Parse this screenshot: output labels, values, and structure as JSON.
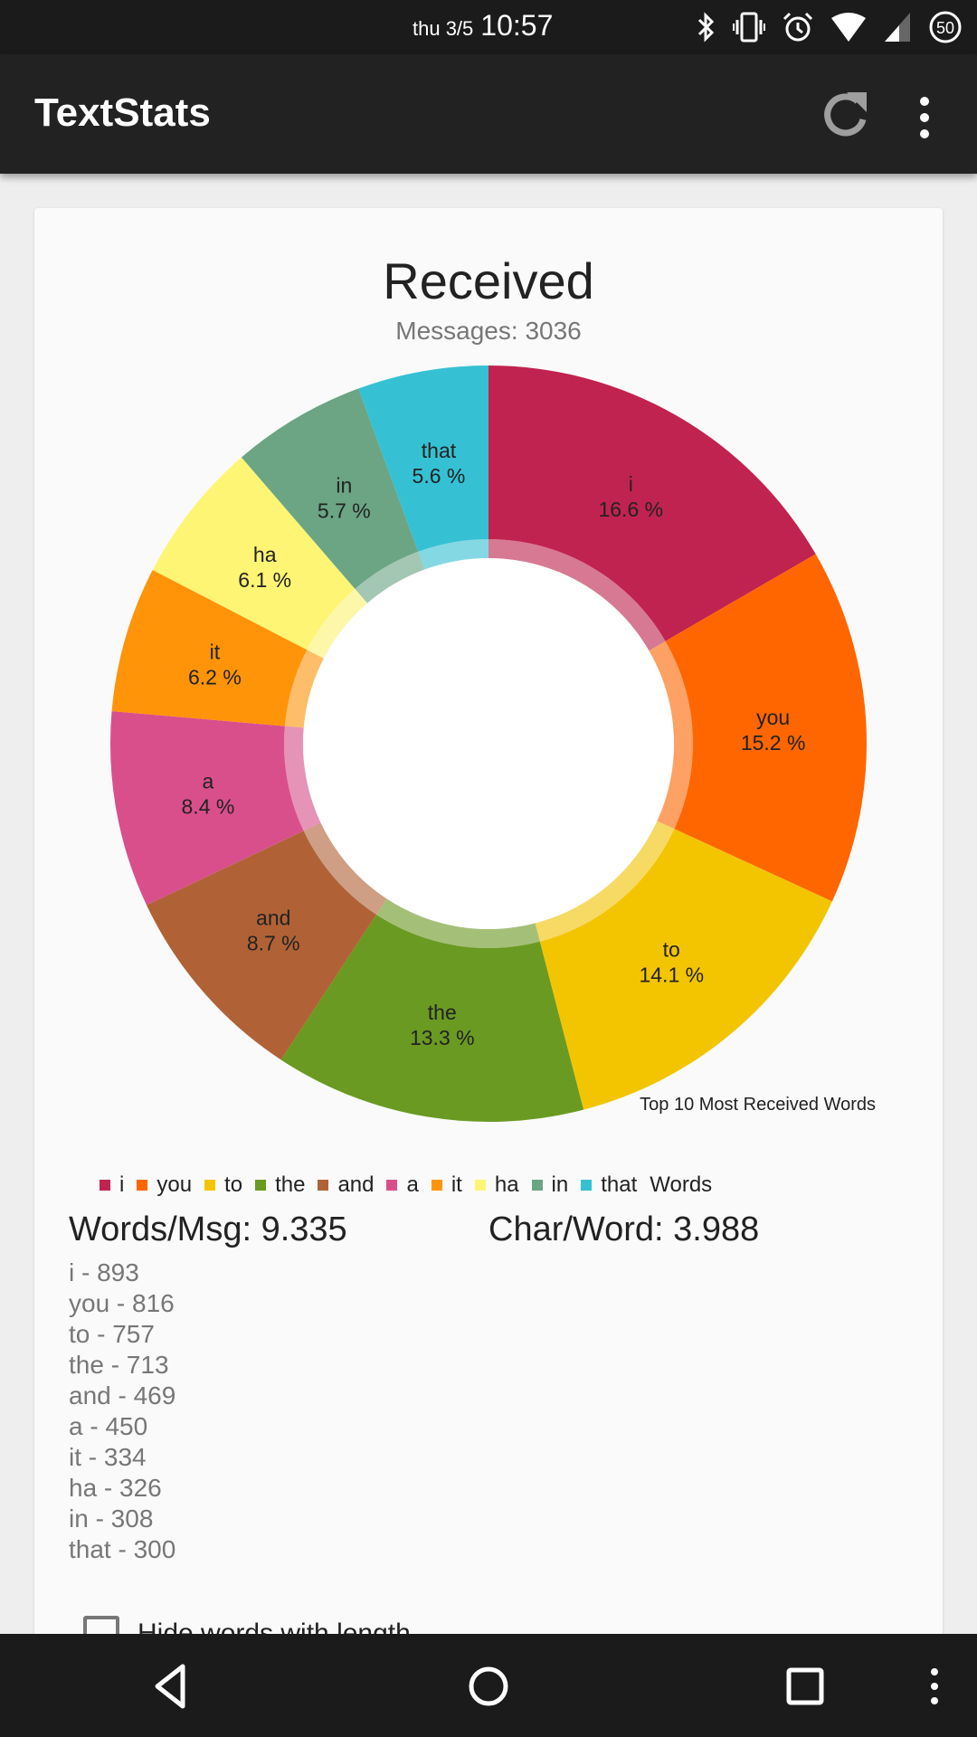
{
  "status_bar": {
    "date": "thu 3/5",
    "time": "10:57",
    "battery": "50",
    "icons": [
      "bluetooth-icon",
      "vibrate-icon",
      "alarm-icon",
      "wifi-icon",
      "cell-signal-icon",
      "battery-icon"
    ]
  },
  "app_bar": {
    "title": "TextStats",
    "actions": [
      "refresh-icon",
      "more-vert-icon"
    ]
  },
  "card": {
    "title": "Received",
    "subtitle": "Messages: 3036",
    "stats": {
      "words_per_msg": "Words/Msg: 9.335",
      "char_per_word": "Char/Word: 3.988"
    },
    "word_counts": [
      "i - 893",
      "you - 816",
      "to - 757",
      "the - 713",
      "and - 469",
      "a - 450",
      "it - 334",
      "ha - 326",
      "in - 308",
      "that - 300"
    ],
    "checkbox_label": "Hide words with length",
    "checkbox_checked": false
  },
  "chart_data": {
    "type": "pie",
    "variant": "donut",
    "title": "Top 10 Most Received Words",
    "legend_title": "Words",
    "legend_position": "bottom",
    "categories": [
      "i",
      "you",
      "to",
      "the",
      "and",
      "a",
      "it",
      "ha",
      "in",
      "that"
    ],
    "values": [
      893,
      816,
      757,
      713,
      469,
      450,
      334,
      326,
      308,
      300
    ],
    "percent_labels": [
      "16.6 %",
      "15.2 %",
      "14.1 %",
      "13.3 %",
      "8.7 %",
      "8.4 %",
      "6.2 %",
      "6.1 %",
      "5.7 %",
      "5.6 %"
    ],
    "colors": [
      "#C0234F",
      "#FF6600",
      "#F3C500",
      "#6A9A22",
      "#B06236",
      "#D94F8C",
      "#FF9408",
      "#FFF574",
      "#6BA584",
      "#35C1D3"
    ]
  },
  "nav_bar": {
    "buttons": [
      "back-icon",
      "home-icon",
      "recents-icon",
      "menu-icon"
    ]
  }
}
